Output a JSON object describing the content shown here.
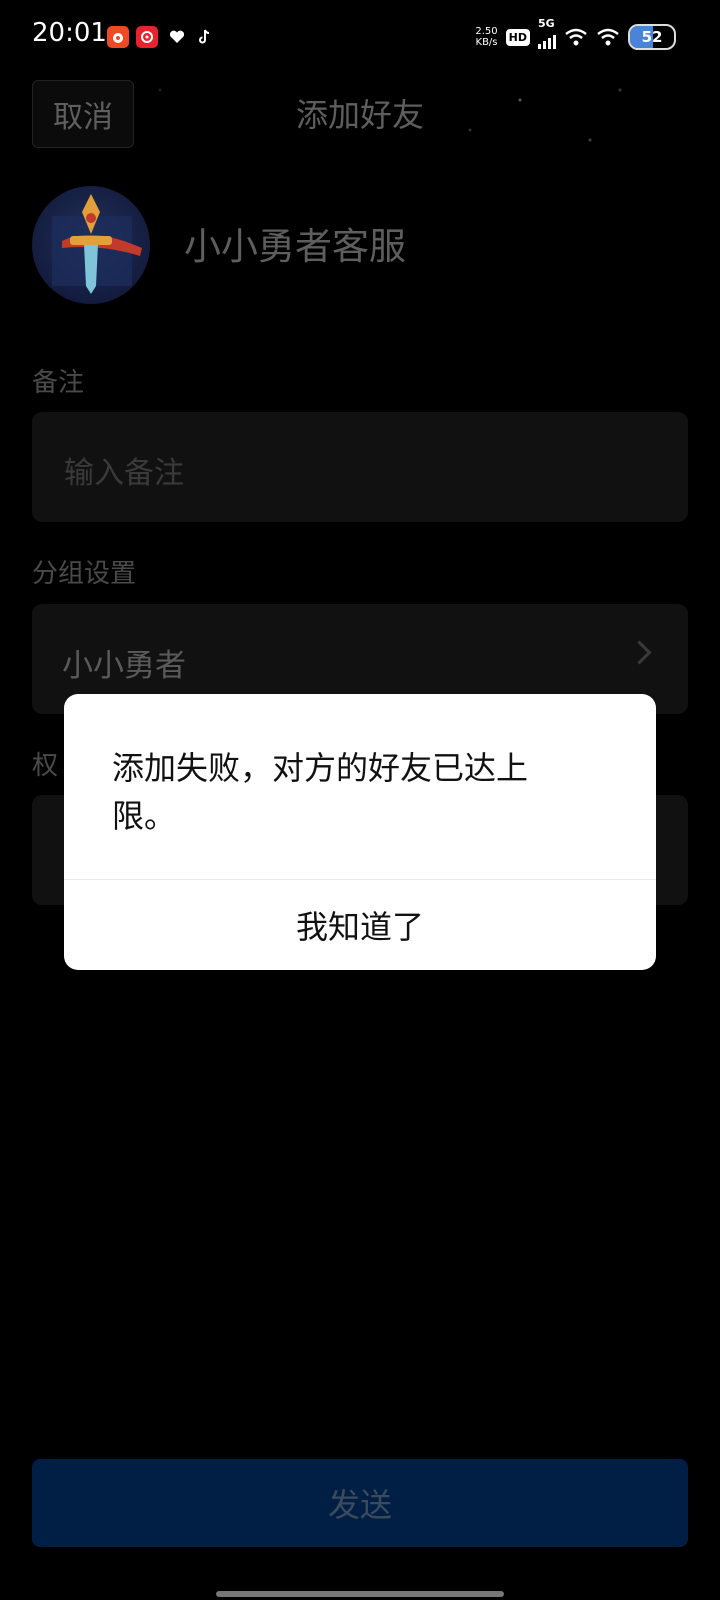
{
  "status_bar": {
    "time": "20:01",
    "net_speed_value": "2.50",
    "net_speed_unit": "KB/s",
    "hd_label": "HD",
    "network_label": "5G",
    "battery_level": "52",
    "notification_icons": [
      "weibo-icon",
      "netease-music-icon",
      "heart-app-icon",
      "tiktok-icon"
    ]
  },
  "header": {
    "cancel_label": "取消",
    "title": "添加好友"
  },
  "profile": {
    "name": "小小勇者客服",
    "avatar_icon": "sword-shield-avatar"
  },
  "form": {
    "remark_label": "备注",
    "remark_placeholder": "输入备注",
    "group_label": "分组设置",
    "group_value": "小小勇者",
    "permission_label_partial": "权"
  },
  "footer": {
    "send_label": "发送"
  },
  "dialog": {
    "message": "添加失败，对方的好友已达上限。",
    "confirm_label": "我知道了"
  },
  "colors": {
    "background": "#000000",
    "send_button": "#011f44",
    "dialog_bg": "#ffffff"
  }
}
